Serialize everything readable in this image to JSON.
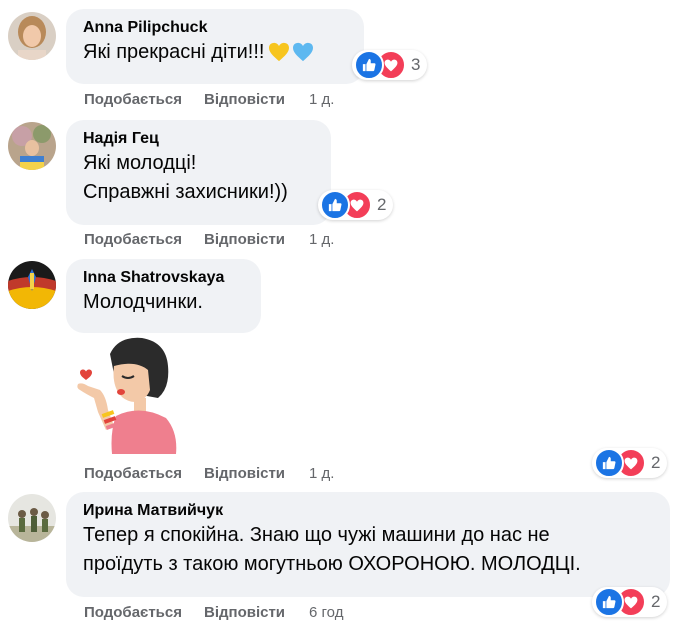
{
  "comments": [
    {
      "author": "Anna Pilipchuck",
      "lines": [
        "Які прекрасні діти!!!"
      ],
      "emojis": [
        "yellow-heart",
        "blue-heart"
      ],
      "reaction_count": "3",
      "actions": {
        "like": "Подобається",
        "reply": "Відповісти",
        "time": "1 д."
      }
    },
    {
      "author": "Надія Гец",
      "lines": [
        "Які молодці!",
        "Справжні захисники!))"
      ],
      "reaction_count": "2",
      "actions": {
        "like": "Подобається",
        "reply": "Відповісти",
        "time": "1 д."
      }
    },
    {
      "author": "Inna Shatrovskaya",
      "lines": [
        "Молодчинки."
      ],
      "sticker": "woman-blowing-kiss-sticker",
      "reaction_count": "2",
      "actions": {
        "like": "Подобається",
        "reply": "Відповісти",
        "time": "1 д."
      }
    },
    {
      "author": "Ирина Матвийчук",
      "lines": [
        "Тепер я спокійна. Знаю що чужі машини до нас не",
        "проїдуть з такою могутньою ОХОРОНОЮ. МОЛОДЦІ."
      ],
      "reaction_count": "2",
      "actions": {
        "like": "Подобається",
        "reply": "Відповісти",
        "time": "6 год"
      }
    }
  ],
  "colors": {
    "bubble": "#f0f2f5",
    "meta_text": "#65676b",
    "like_blue": "#1b74e4",
    "love_red": "#f33e58"
  }
}
